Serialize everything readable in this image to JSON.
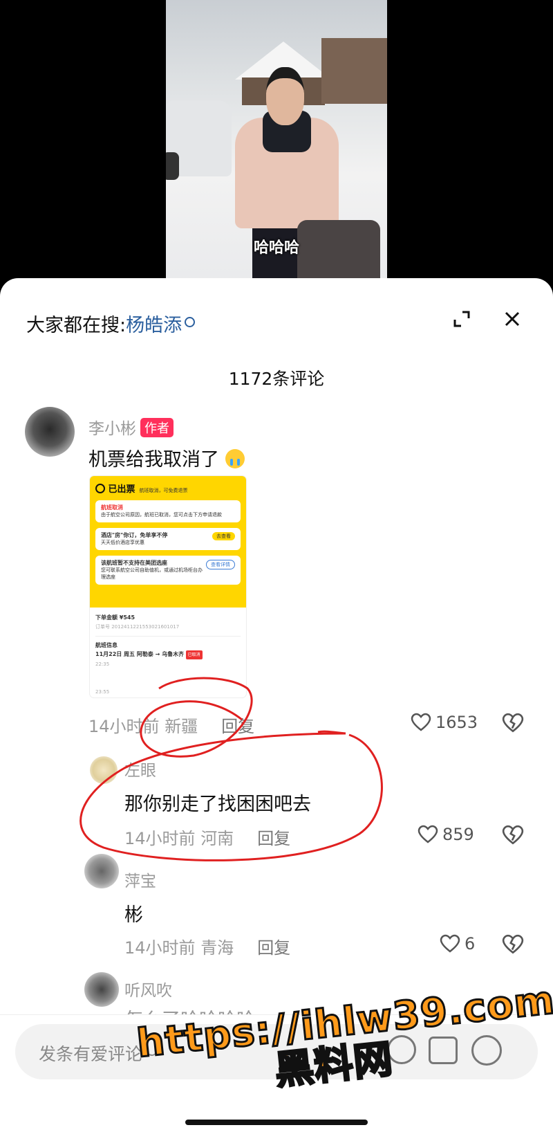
{
  "video": {
    "subtitle": "哈哈哈"
  },
  "header": {
    "search_prefix": "大家都在搜:",
    "search_keyword": "杨皓添"
  },
  "comment_count": "1172条评论",
  "comments": [
    {
      "name": "李小彬",
      "tag": "作者",
      "text": "机票给我取消了",
      "time": "14小时前",
      "location": "新疆",
      "reply": "回复",
      "likes": "1653"
    },
    {
      "name": "左眼",
      "text": "那你别走了找困困吧去",
      "time": "14小时前",
      "location": "河南",
      "reply": "回复",
      "likes": "859"
    },
    {
      "name": "萍宝",
      "text": "彬",
      "time": "14小时前",
      "location": "青海",
      "reply": "回复",
      "likes": "6"
    },
    {
      "name": "听风吹",
      "text": "怎么了哈哈哈哈"
    }
  ],
  "ticket": {
    "status": "已出票",
    "status_note": "航班取消，可免费退票",
    "card1_title": "航班取消",
    "card1_text": "由于航空公司原因，航班已取消，您可点击下方申请退款",
    "card2_title": "酒店\"房\"你订，免单享不停",
    "card2_text": "天天低价酒店享优惠",
    "card2_btn": "去查看",
    "card3_title": "该航班暂不支持在美团选座",
    "card3_text": "您可联系航空公司自助值机，或通过机场柜台办理选座",
    "card3_btn": "查看详情",
    "amount": "下单金额 ¥545",
    "order_no": "订单号 2012411221553021601017",
    "flight_info": "航班信息",
    "flight_route": "11月22日 周五 阿勒泰 → 乌鲁木齐",
    "cancel_chip": "已取消",
    "depart_time": "22:35",
    "arrive_time": "23:55"
  },
  "input": {
    "placeholder": "发条有爱评论~"
  },
  "watermark": {
    "line1": "https://ihlw39.com",
    "line2": "黑料网"
  },
  "colors": {
    "author_tag": "#ff2f5b",
    "search_keyword": "#2b5f9e",
    "ticket_yellow": "#ffd600",
    "annotation_red": "#e02020"
  }
}
